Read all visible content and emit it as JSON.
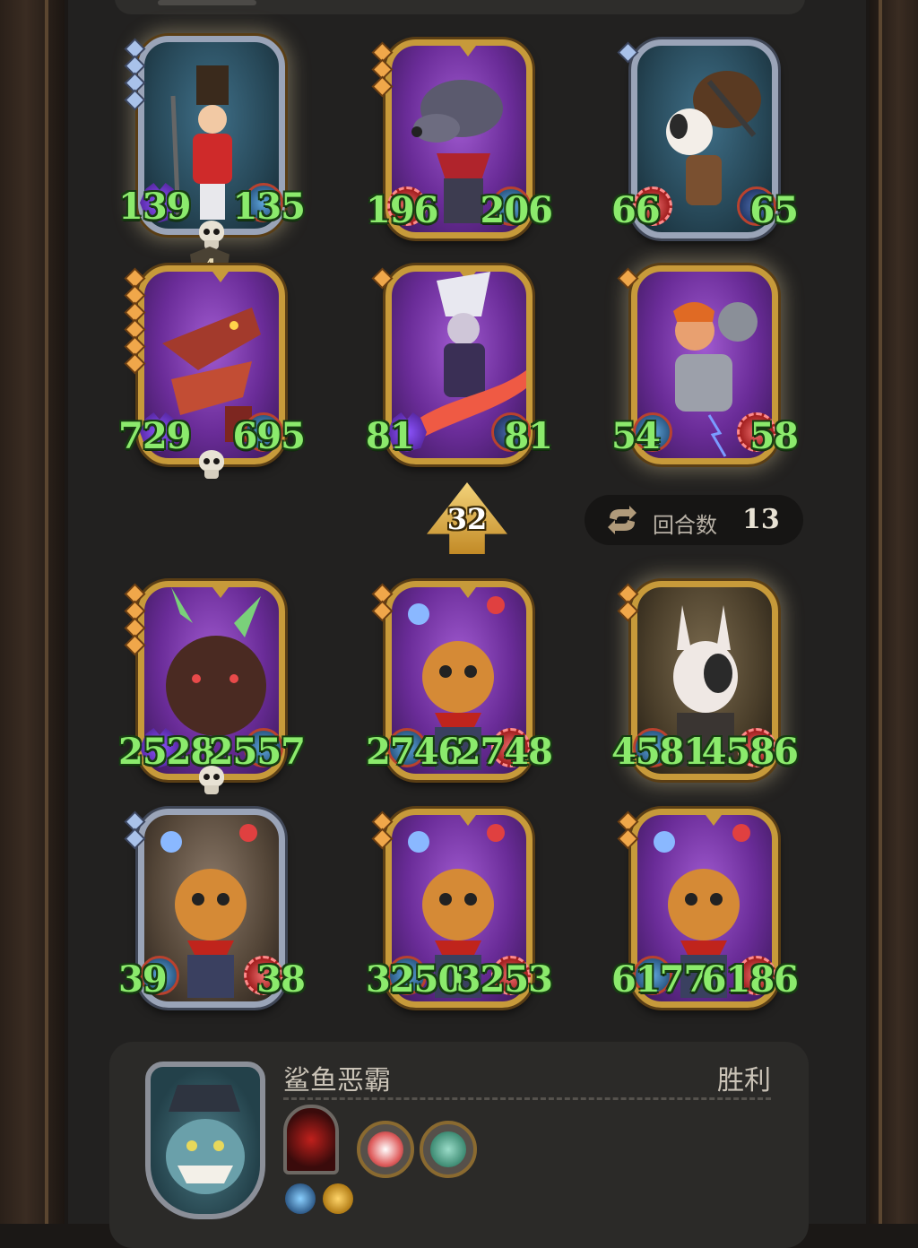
{
  "round": {
    "label": "回合数",
    "value": "13"
  },
  "speed": {
    "value": "32"
  },
  "top_panel_level": {
    "value": "4"
  },
  "enemy_rows": [
    [
      {
        "attack": "139",
        "health": "135",
        "left_badge": "purple-spiky",
        "right_badge": "blue",
        "frame": "silver",
        "skull": true
      },
      {
        "attack": "196",
        "health": "206",
        "left_badge": "red",
        "right_badge": "blue",
        "frame": "gold",
        "skull": false
      },
      {
        "attack": "66",
        "health": "65",
        "left_badge": "red",
        "right_badge": "navy",
        "frame": "silver",
        "skull": false
      }
    ],
    [
      {
        "attack": "729",
        "health": "695",
        "left_badge": "purple-spiky",
        "right_badge": "blue",
        "frame": "gold",
        "skull": true
      },
      {
        "attack": "81",
        "health": "81",
        "left_badge": "purple-spiky",
        "right_badge": "navy",
        "frame": "gold",
        "skull": false
      },
      {
        "attack": "54",
        "health": "58",
        "left_badge": "blue",
        "right_badge": "red",
        "frame": "gold",
        "skull": false
      }
    ]
  ],
  "ally_rows": [
    [
      {
        "attack": "2528",
        "health": "2557",
        "left_badge": "purple-spiky",
        "right_badge": "blue",
        "frame": "gold",
        "skull": true
      },
      {
        "attack": "2746",
        "health": "2748",
        "left_badge": "blue",
        "right_badge": "red",
        "frame": "gold",
        "skull": false
      },
      {
        "attack": "4581",
        "health": "4586",
        "left_badge": "blue",
        "right_badge": "red",
        "frame": "gold",
        "skull": false
      }
    ],
    [
      {
        "attack": "39",
        "health": "38",
        "left_badge": "blue",
        "right_badge": "red",
        "frame": "silver",
        "skull": false
      },
      {
        "attack": "3250",
        "health": "3253",
        "left_badge": "blue",
        "right_badge": "red",
        "frame": "gold",
        "skull": false
      },
      {
        "attack": "6177",
        "health": "6186",
        "left_badge": "blue",
        "right_badge": "red",
        "frame": "gold",
        "skull": false
      }
    ]
  ],
  "player": {
    "name": "鲨鱼恶霸",
    "result": "胜利"
  },
  "colors": {
    "stat_green": "#8bea6c",
    "gold_frame": "#c79a3a",
    "silver_frame": "#9aa4b8"
  }
}
